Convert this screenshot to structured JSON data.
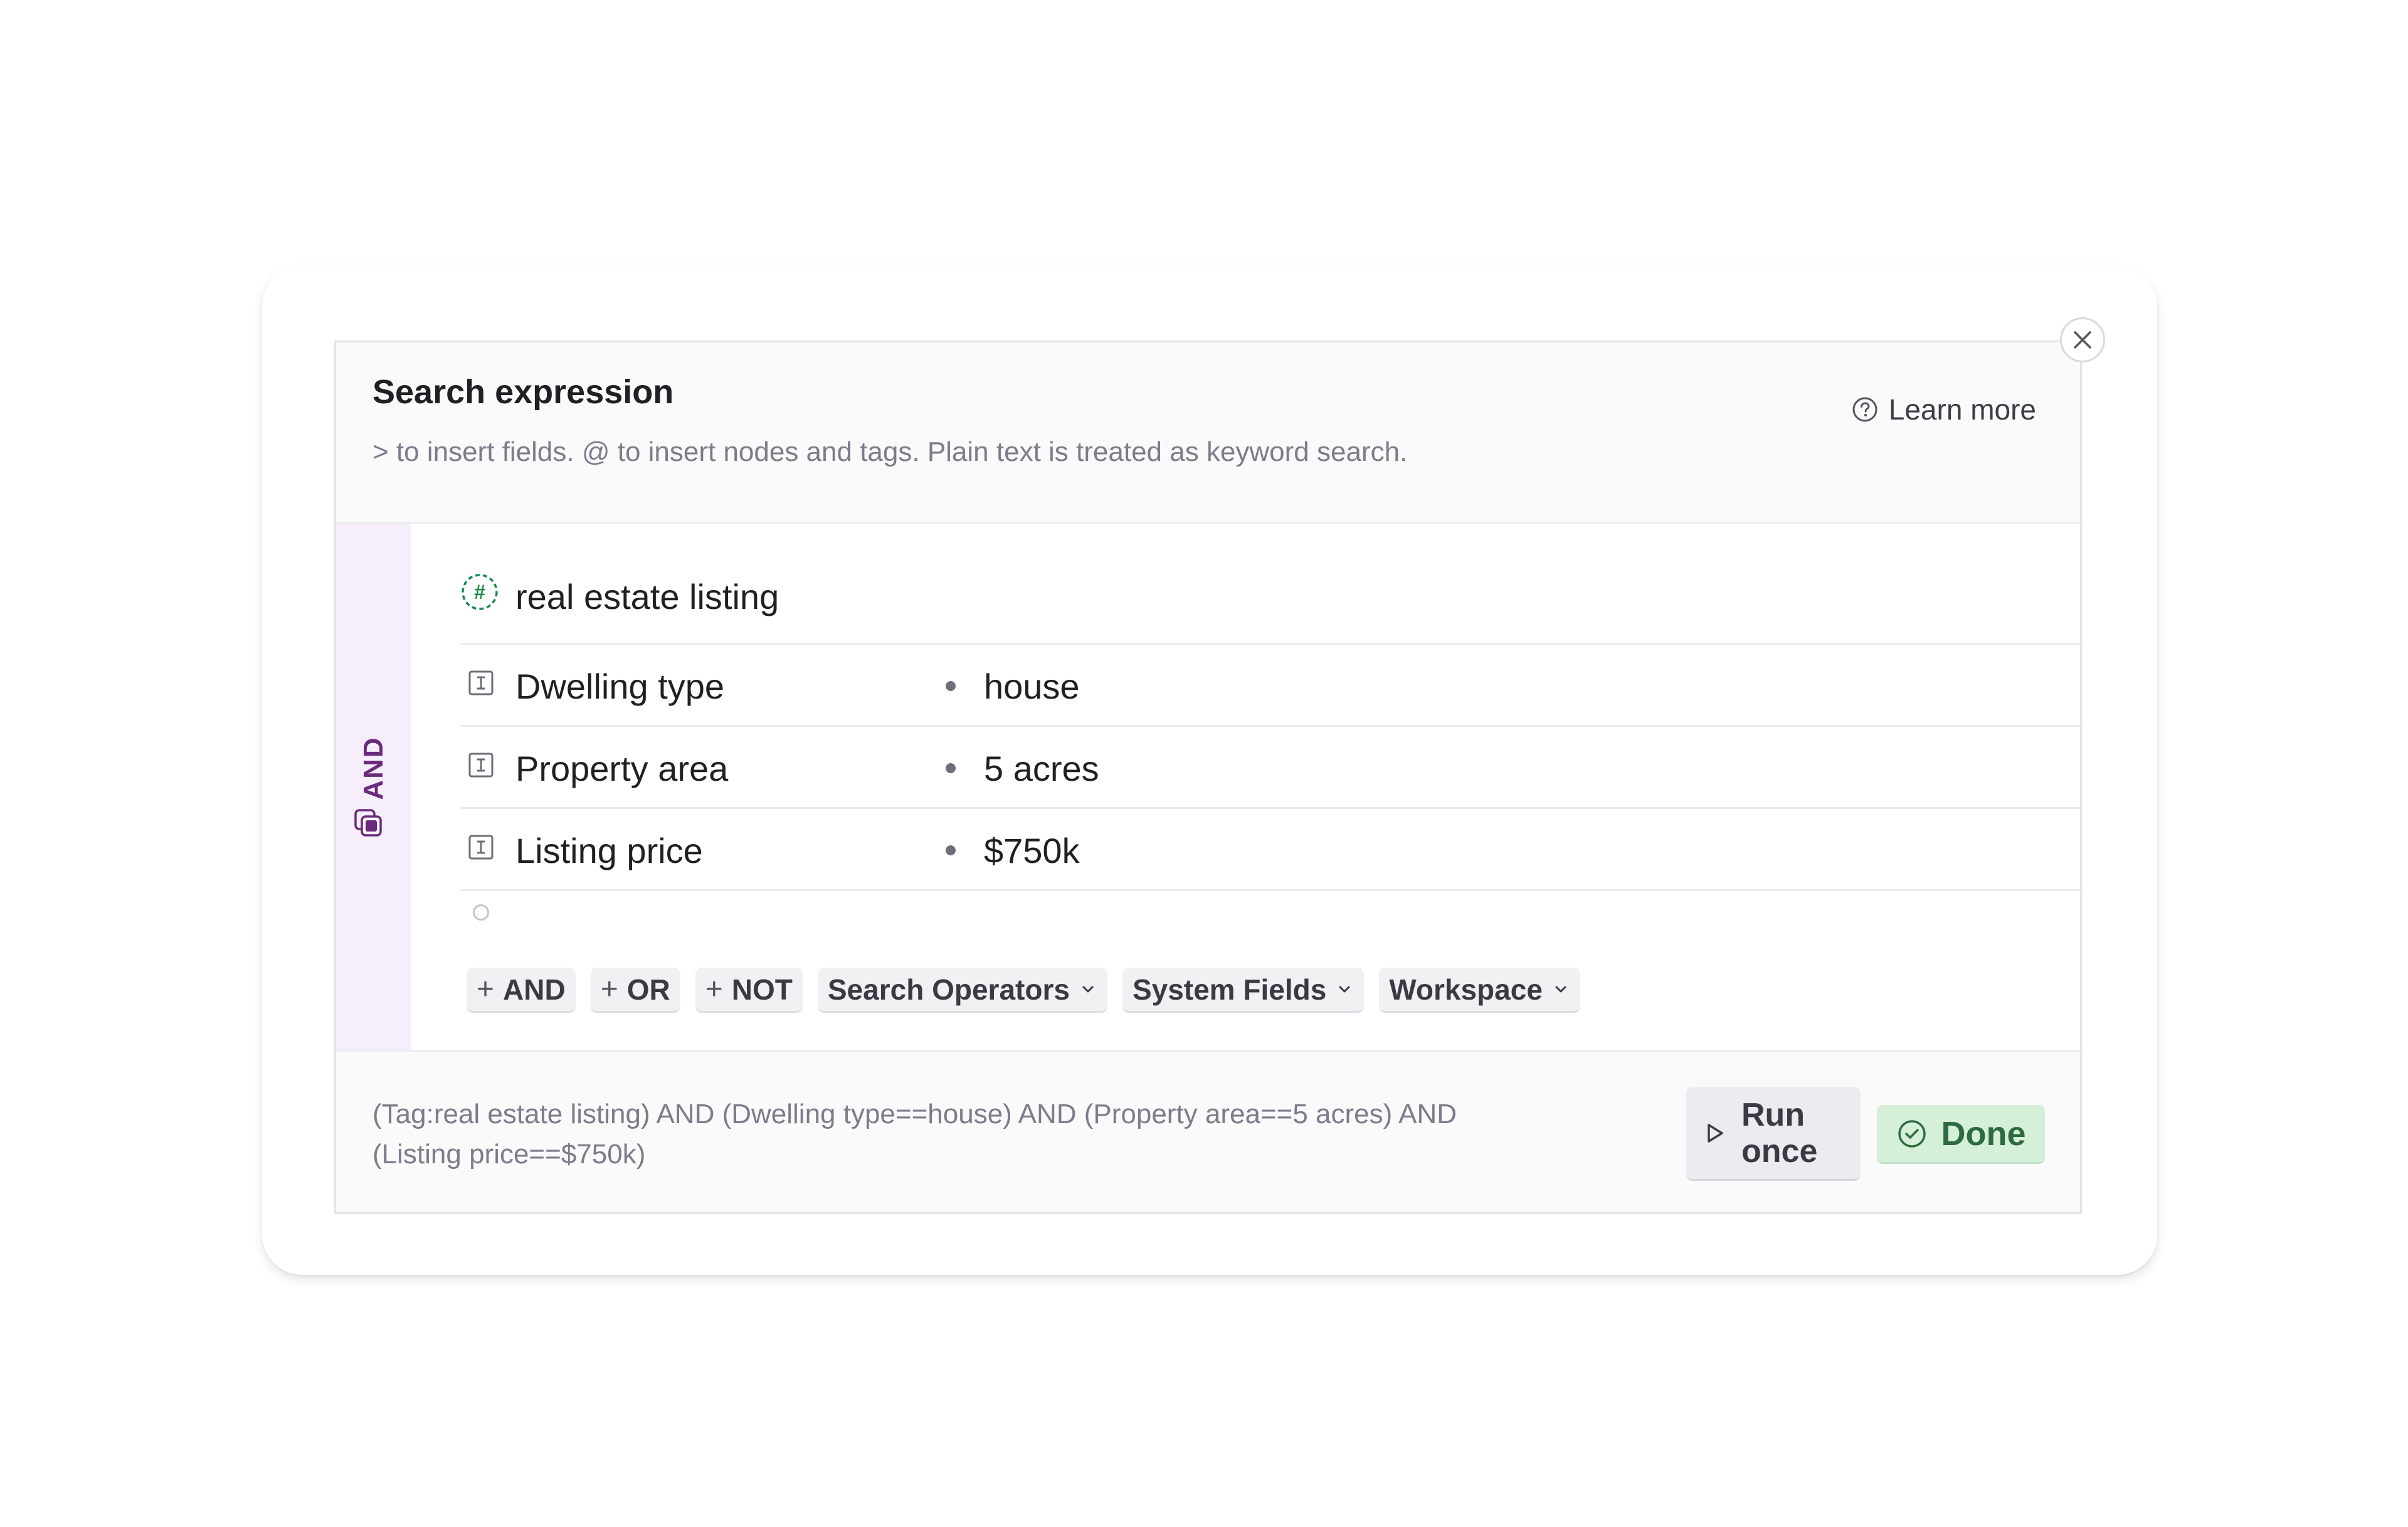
{
  "dialog": {
    "title": "Search expression",
    "subtitle": "> to insert fields. @ to insert nodes and tags. Plain text is treated as keyword search.",
    "learn_more": "Learn more",
    "close_icon": "close-icon"
  },
  "group": {
    "operator": "AND",
    "icon": "and-group-icon",
    "tag": {
      "label": "real estate listing",
      "icon": "hash-tag-icon",
      "color": "#1a8a4a"
    },
    "fields": [
      {
        "name": "Dwelling type",
        "value": "house",
        "icon": "text-field-icon"
      },
      {
        "name": "Property area",
        "value": "5 acres",
        "icon": "text-field-icon"
      },
      {
        "name": "Listing price",
        "value": "$750k",
        "icon": "text-field-icon"
      }
    ]
  },
  "toolbar": {
    "add_and": "AND",
    "add_or": "OR",
    "add_not": "NOT",
    "search_operators": "Search Operators",
    "system_fields": "System Fields",
    "workspace": "Workspace"
  },
  "footer": {
    "query_line1": "(Tag:real estate listing) AND (Dwelling type==house) AND (Property area==5 acres) AND",
    "query_line2": "(Listing price==$750k)",
    "run_line1": "Run",
    "run_line2": "once",
    "done": "Done"
  },
  "colors": {
    "accent_purple": "#6b2a7d",
    "and_bar_bg": "#f6effb",
    "done_bg": "#d6efd9",
    "done_text": "#2e6b3e"
  }
}
